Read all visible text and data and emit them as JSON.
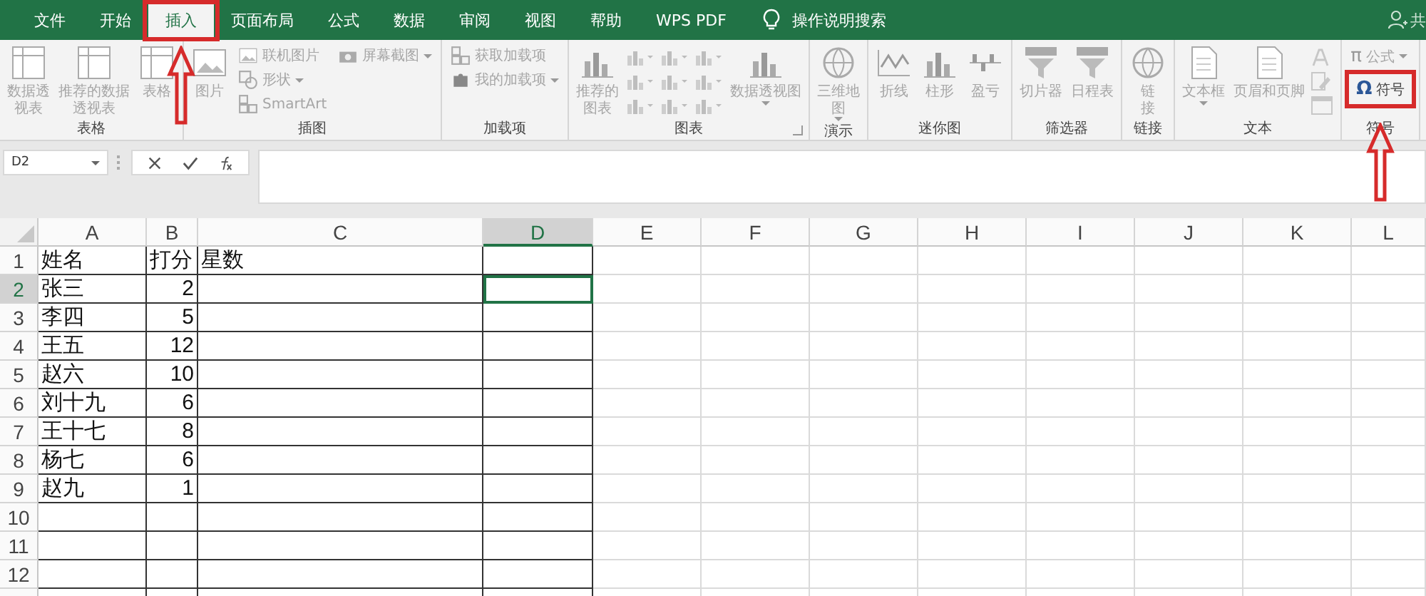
{
  "tabs": [
    {
      "label": "文件",
      "selected": false,
      "highlighted": false
    },
    {
      "label": "开始",
      "selected": false,
      "highlighted": false
    },
    {
      "label": "插入",
      "selected": true,
      "highlighted": true
    },
    {
      "label": "页面布局",
      "selected": false,
      "highlighted": false
    },
    {
      "label": "公式",
      "selected": false,
      "highlighted": false
    },
    {
      "label": "数据",
      "selected": false,
      "highlighted": false
    },
    {
      "label": "审阅",
      "selected": false,
      "highlighted": false
    },
    {
      "label": "视图",
      "selected": false,
      "highlighted": false
    },
    {
      "label": "帮助",
      "selected": false,
      "highlighted": false
    },
    {
      "label": "WPS PDF",
      "selected": false,
      "highlighted": false
    }
  ],
  "tell_me": "操作说明搜索",
  "share": "共",
  "ribbon_groups": [
    {
      "label": "表格",
      "columns": [
        [
          {
            "label": "数据透视表",
            "multiline": true,
            "kind": "large",
            "disabled": true
          }
        ],
        [
          {
            "label": "推荐的数据透视表",
            "multiline": true,
            "kind": "large",
            "disabled": true
          }
        ],
        [
          {
            "label": "表格",
            "kind": "large",
            "disabled": true
          }
        ]
      ]
    },
    {
      "label": "插图",
      "columns": [
        [
          {
            "label": "图片",
            "kind": "large",
            "disabled": true
          }
        ],
        [
          {
            "label": "联机图片",
            "kind": "small",
            "disabled": true
          },
          {
            "label": "形状",
            "kind": "small",
            "disabled": true,
            "dropdown": true
          },
          {
            "label": "SmartArt",
            "kind": "small",
            "disabled": true
          }
        ],
        [
          {
            "label": "屏幕截图",
            "kind": "small",
            "disabled": true,
            "dropdown": true
          }
        ]
      ]
    },
    {
      "label": "加载项",
      "columns": [
        [
          {
            "label": "获取加载项",
            "kind": "small",
            "disabled": true
          },
          {
            "label": "我的加载项",
            "kind": "small",
            "disabled": true,
            "dropdown": true
          }
        ]
      ]
    },
    {
      "label": "图表",
      "launcher": true,
      "columns": [
        [
          {
            "label": "推荐的图表",
            "multiline": true,
            "kind": "large",
            "disabled": true
          }
        ],
        [
          {
            "kind": "iconset",
            "disabled": true
          }
        ],
        [
          {
            "label": "数据透视图",
            "kind": "large",
            "disabled": true,
            "dropdown": true
          }
        ]
      ]
    },
    {
      "label": "演示",
      "columns": [
        [
          {
            "label": "三维地图",
            "multiline": true,
            "kind": "large",
            "disabled": true,
            "dropdown": true
          }
        ]
      ]
    },
    {
      "label": "迷你图",
      "columns": [
        [
          {
            "label": "折线",
            "kind": "large",
            "disabled": true
          }
        ],
        [
          {
            "label": "柱形",
            "kind": "large",
            "disabled": true
          }
        ],
        [
          {
            "label": "盈亏",
            "kind": "large",
            "disabled": true
          }
        ]
      ]
    },
    {
      "label": "筛选器",
      "columns": [
        [
          {
            "label": "切片器",
            "kind": "large",
            "disabled": true
          }
        ],
        [
          {
            "label": "日程表",
            "kind": "large",
            "disabled": true
          }
        ]
      ]
    },
    {
      "label": "链接",
      "columns": [
        [
          {
            "label": "链接",
            "multiline": true,
            "kind": "large",
            "disabled": true
          }
        ]
      ]
    },
    {
      "label": "文本",
      "columns": [
        [
          {
            "label": "文本框",
            "kind": "large",
            "disabled": true,
            "dropdown": true
          }
        ],
        [
          {
            "label": "页眉和页脚",
            "kind": "large",
            "disabled": true
          }
        ],
        [
          {
            "kind": "iconstack",
            "disabled": true
          }
        ]
      ]
    },
    {
      "label": "符号",
      "columns": [
        [
          {
            "label": "公式",
            "glyph": "π",
            "kind": "small",
            "disabled": true,
            "dropdown": true
          },
          {
            "label": "符号",
            "glyph": "Ω",
            "kind": "small",
            "disabled": false,
            "highlighted": true
          }
        ]
      ]
    }
  ],
  "name_box": "D2",
  "columns": [
    {
      "label": "A",
      "selected": false
    },
    {
      "label": "B",
      "selected": false
    },
    {
      "label": "C",
      "selected": false
    },
    {
      "label": "D",
      "selected": true
    },
    {
      "label": "E",
      "selected": false
    },
    {
      "label": "F",
      "selected": false
    },
    {
      "label": "G",
      "selected": false
    },
    {
      "label": "H",
      "selected": false
    },
    {
      "label": "I",
      "selected": false
    },
    {
      "label": "J",
      "selected": false
    },
    {
      "label": "K",
      "selected": false
    },
    {
      "label": "L",
      "selected": false
    }
  ],
  "rows": [
    {
      "number": "1",
      "selected": false,
      "cells": [
        "姓名",
        "打分",
        "星数"
      ]
    },
    {
      "number": "2",
      "selected": true,
      "cells": [
        "张三",
        "2"
      ]
    },
    {
      "number": "3",
      "selected": false,
      "cells": [
        "李四",
        "5"
      ]
    },
    {
      "number": "4",
      "selected": false,
      "cells": [
        "王五",
        "12"
      ]
    },
    {
      "number": "5",
      "selected": false,
      "cells": [
        "赵六",
        "10"
      ]
    },
    {
      "number": "6",
      "selected": false,
      "cells": [
        "刘十九",
        "6"
      ]
    },
    {
      "number": "7",
      "selected": false,
      "cells": [
        "王十七",
        "8"
      ]
    },
    {
      "number": "8",
      "selected": false,
      "cells": [
        "杨七",
        "6"
      ]
    },
    {
      "number": "9",
      "selected": false,
      "cells": [
        "赵九",
        "1"
      ]
    },
    {
      "number": "10",
      "selected": false,
      "cells": []
    },
    {
      "number": "11",
      "selected": false,
      "cells": []
    },
    {
      "number": "12",
      "selected": false,
      "cells": []
    }
  ]
}
